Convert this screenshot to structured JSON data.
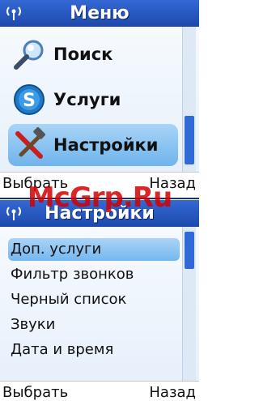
{
  "screens": [
    {
      "title": "Меню",
      "items": [
        {
          "label": "Поиск",
          "icon": "magnifier-icon"
        },
        {
          "label": "Услуги",
          "icon": "skype-icon"
        },
        {
          "label": "Настройки",
          "icon": "tools-icon",
          "selected": true
        }
      ],
      "softkeys": {
        "left": "Выбрать",
        "right": "Назад"
      }
    },
    {
      "title": "Настройки",
      "items": [
        {
          "label": "Доп. услуги",
          "selected": true
        },
        {
          "label": "Фильтр звонков"
        },
        {
          "label": "Черный список"
        },
        {
          "label": "Звуки"
        },
        {
          "label": "Дата и время"
        }
      ],
      "softkeys": {
        "left": "Выбрать",
        "right": "Назад"
      }
    }
  ],
  "watermark": "McGrp.Ru",
  "colors": {
    "titlebar": "#1d49ad",
    "selection": "#74b8ee",
    "scroll_thumb": "#2f6ad6",
    "watermark": "#d20000"
  }
}
